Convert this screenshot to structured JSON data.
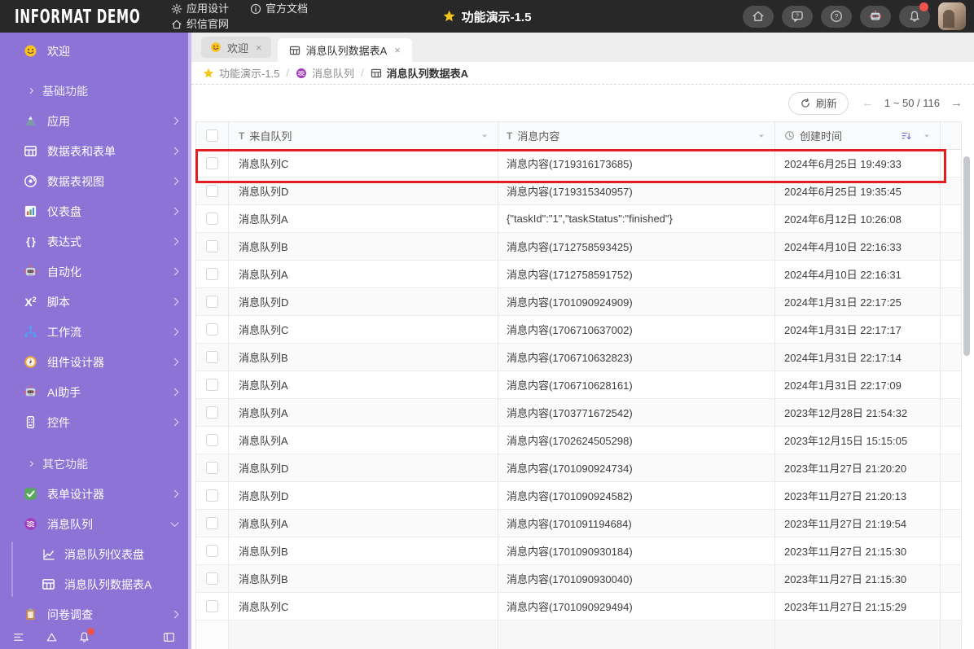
{
  "topbar": {
    "logo": "INFORMAT DEMO",
    "menu": [
      {
        "icon": "gear-icon",
        "label": "应用设计"
      },
      {
        "icon": "info-icon",
        "label": "官方文档"
      },
      {
        "icon": "home-icon",
        "label": "织信官网"
      }
    ],
    "title": {
      "icon": "star-icon",
      "label": "功能演示-1.5"
    },
    "actions": [
      "home-icon",
      "feedback-icon",
      "help-icon",
      "robot-icon",
      "bell-icon",
      "avatar"
    ]
  },
  "sidebar": {
    "items": [
      {
        "label": "欢迎",
        "icon": "smiley-icon"
      },
      {
        "label": "基础功能",
        "icon": "chevron-right-icon",
        "type": "section"
      },
      {
        "label": "应用",
        "icon": "mountain-icon"
      },
      {
        "label": "数据表和表单",
        "icon": "table-grid-icon"
      },
      {
        "label": "数据表视图",
        "icon": "view-icon"
      },
      {
        "label": "仪表盘",
        "icon": "bar-chart-icon"
      },
      {
        "label": "表达式",
        "icon": "braces-icon",
        "glyph": "{ }"
      },
      {
        "label": "自动化",
        "icon": "robot-icon"
      },
      {
        "label": "脚本",
        "icon": "script-icon",
        "glyph_main": "X",
        "glyph_sub": "2"
      },
      {
        "label": "工作流",
        "icon": "workflow-icon"
      },
      {
        "label": "组件设计器",
        "icon": "compass-icon"
      },
      {
        "label": "AI助手",
        "icon": "robot-icon"
      },
      {
        "label": "控件",
        "icon": "widget-icon"
      },
      {
        "label": "其它功能",
        "icon": "chevron-right-icon",
        "type": "section"
      },
      {
        "label": "表单设计器",
        "icon": "check-icon"
      },
      {
        "label": "消息队列",
        "icon": "queue-icon",
        "expanded": true
      },
      {
        "label": "消息队列仪表盘",
        "icon": "line-chart-icon",
        "sub": true
      },
      {
        "label": "消息队列数据表A",
        "icon": "table-grid-icon",
        "sub": true,
        "active": true
      },
      {
        "label": "问卷调查",
        "icon": "clipboard-icon"
      }
    ]
  },
  "tabs": {
    "close_glyph": "×",
    "items": [
      {
        "icon": "smiley-icon",
        "label": "欢迎",
        "active": false
      },
      {
        "icon": "table-grid-icon",
        "label": "消息队列数据表A",
        "active": true
      }
    ]
  },
  "breadcrumb": {
    "separator": "/",
    "items": [
      {
        "icon": "star-icon",
        "label": "功能演示-1.5"
      },
      {
        "icon": "queue-icon",
        "label": "消息队列"
      },
      {
        "icon": "table-grid-icon",
        "label": "消息队列数据表A"
      }
    ]
  },
  "toolbar": {
    "refresh_label": "刷新",
    "prev_glyph": "←",
    "next_glyph": "→",
    "pagination": "1 ~ 50 / 116"
  },
  "table": {
    "columns": [
      {
        "icon": "text-filter-icon",
        "glyph": "T",
        "label": "来自队列"
      },
      {
        "icon": "text-filter-icon",
        "glyph": "T",
        "label": "消息内容"
      },
      {
        "icon": "clock-icon",
        "label": "创建时间",
        "sorted": true
      }
    ],
    "highlighted_row": 0,
    "highlight_color": "#e02020",
    "rows": [
      {
        "queue": "消息队列C",
        "content": "消息内容(1719316173685)",
        "time": "2024年6月25日 19:49:33"
      },
      {
        "queue": "消息队列D",
        "content": "消息内容(1719315340957)",
        "time": "2024年6月25日 19:35:45"
      },
      {
        "queue": "消息队列A",
        "content": "{\"taskId\":\"1\",\"taskStatus\":\"finished\"}",
        "time": "2024年6月12日 10:26:08"
      },
      {
        "queue": "消息队列B",
        "content": "消息内容(1712758593425)",
        "time": "2024年4月10日 22:16:33"
      },
      {
        "queue": "消息队列A",
        "content": "消息内容(1712758591752)",
        "time": "2024年4月10日 22:16:31"
      },
      {
        "queue": "消息队列D",
        "content": "消息内容(1701090924909)",
        "time": "2024年1月31日 22:17:25"
      },
      {
        "queue": "消息队列C",
        "content": "消息内容(1706710637002)",
        "time": "2024年1月31日 22:17:17"
      },
      {
        "queue": "消息队列B",
        "content": "消息内容(1706710632823)",
        "time": "2024年1月31日 22:17:14"
      },
      {
        "queue": "消息队列A",
        "content": "消息内容(1706710628161)",
        "time": "2024年1月31日 22:17:09"
      },
      {
        "queue": "消息队列A",
        "content": "消息内容(1703771672542)",
        "time": "2023年12月28日 21:54:32"
      },
      {
        "queue": "消息队列A",
        "content": "消息内容(1702624505298)",
        "time": "2023年12月15日 15:15:05"
      },
      {
        "queue": "消息队列D",
        "content": "消息内容(1701090924734)",
        "time": "2023年11月27日 21:20:20"
      },
      {
        "queue": "消息队列D",
        "content": "消息内容(1701090924582)",
        "time": "2023年11月27日 21:20:13"
      },
      {
        "queue": "消息队列A",
        "content": "消息内容(1701091194684)",
        "time": "2023年11月27日 21:19:54"
      },
      {
        "queue": "消息队列B",
        "content": "消息内容(1701090930184)",
        "time": "2023年11月27日 21:15:30"
      },
      {
        "queue": "消息队列B",
        "content": "消息内容(1701090930040)",
        "time": "2023年11月27日 21:15:30"
      },
      {
        "queue": "消息队列C",
        "content": "消息内容(1701090929494)",
        "time": "2023年11月27日 21:15:29"
      }
    ]
  }
}
